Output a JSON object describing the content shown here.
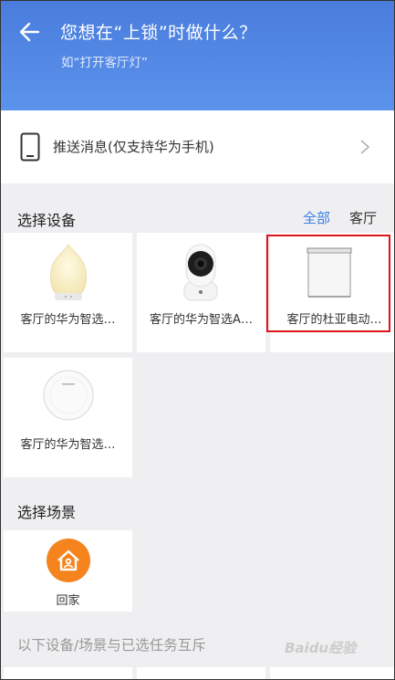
{
  "header": {
    "title": "您想在“上锁”时做什么？",
    "subtitle": "如“打开客厅灯”"
  },
  "push": {
    "label": "推送消息(仅支持华为手机)"
  },
  "devices": {
    "section_title": "选择设备",
    "filters": [
      "全部",
      "客厅"
    ],
    "active_filter_color": "#3a7fe6",
    "items": [
      {
        "label": "客厅的华为智选…",
        "icon": "night-lamp-icon"
      },
      {
        "label": "客厅的华为智选A…",
        "icon": "smart-camera-icon"
      },
      {
        "label": "客厅的杜亚电动…",
        "icon": "curtain-motor-icon"
      },
      {
        "label": "客厅的华为智选…",
        "icon": "round-sensor-icon"
      }
    ]
  },
  "scenes": {
    "section_title": "选择场景",
    "items": [
      {
        "label": "回家",
        "icon": "home-icon",
        "color": "#f5841f"
      }
    ]
  },
  "conflict": {
    "title": "以下设备/场景与已选任务互斥"
  },
  "watermark": "Baidu经验",
  "colors": {
    "header": "#4f86e4",
    "selection_border": "#e0151b"
  }
}
